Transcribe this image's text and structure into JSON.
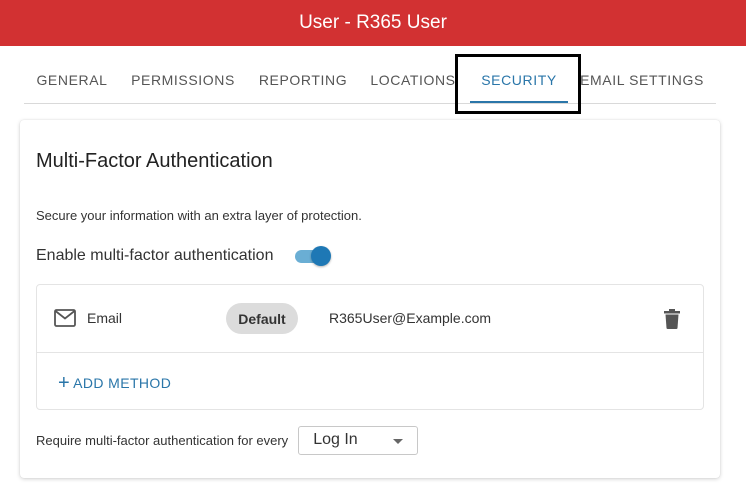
{
  "header": {
    "title": "User - R365 User",
    "color": "#d23132"
  },
  "tabs": [
    {
      "label": "GENERAL"
    },
    {
      "label": "PERMISSIONS"
    },
    {
      "label": "REPORTING"
    },
    {
      "label": "LOCATIONS"
    },
    {
      "label": "SECURITY",
      "active": true
    },
    {
      "label": "EMAIL SETTINGS"
    }
  ],
  "accent_color": "#2a76a9",
  "mfa": {
    "title": "Multi-Factor Authentication",
    "description": "Secure your information with an extra layer of protection.",
    "toggle_label": "Enable multi-factor authentication",
    "enabled": true,
    "methods": [
      {
        "icon": "mail-icon",
        "name": "Email",
        "badge": "Default",
        "value": "R365User@Example.com",
        "action_icon": "trash-icon"
      }
    ],
    "add_method_label": "ADD METHOD",
    "require_label": "Require multi-factor authentication for every",
    "frequency_selected": "Log In"
  }
}
